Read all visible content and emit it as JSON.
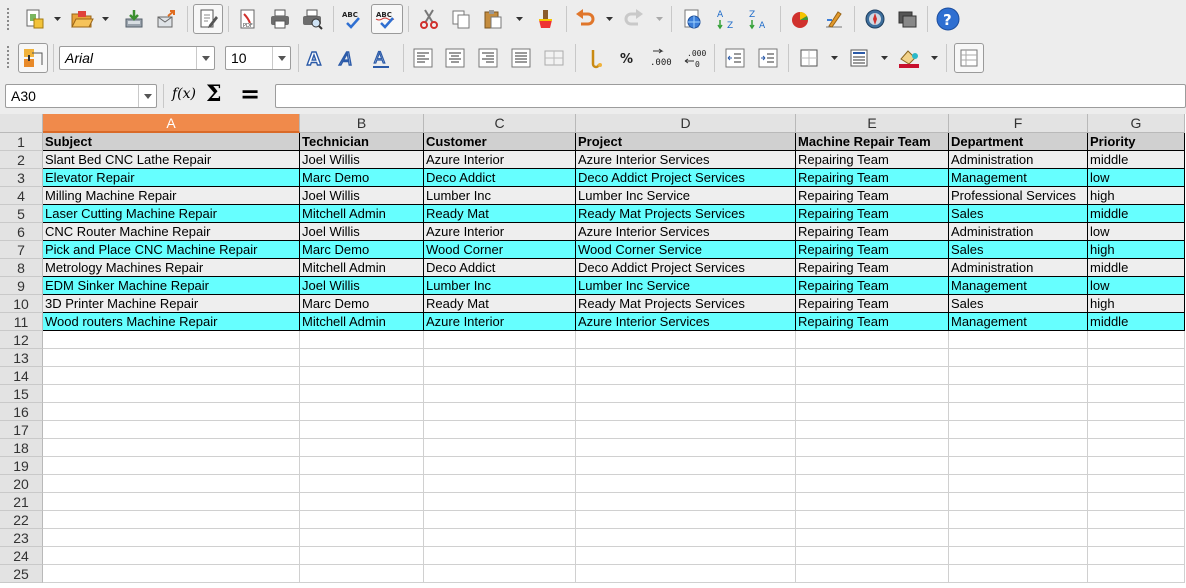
{
  "toolbar1": {
    "buttons": [
      "new-icon",
      "open-icon",
      "save-icon",
      "export-icon",
      "edit-file-icon",
      "export-pdf-icon",
      "print-icon",
      "print-preview-icon",
      "spellcheck-icon",
      "autospellcheck-icon",
      "cut-icon",
      "copy-icon",
      "paste-icon",
      "clone-format-icon",
      "undo-icon",
      "redo-icon",
      "hyperlink-icon",
      "sort-ascending-icon",
      "sort-descending-icon",
      "chart-icon",
      "pivot-table-icon",
      "navigator-icon",
      "gallery-icon",
      "help-icon"
    ]
  },
  "toolbar2": {
    "font_name": "Arial",
    "font_size": "10"
  },
  "formula_bar": {
    "name_box": "A30",
    "function_wizard": "f(x)",
    "sum_symbol": "Σ",
    "equals_symbol": "=",
    "formula_value": ""
  },
  "sheet": {
    "selected_column": "A",
    "columns": [
      "A",
      "B",
      "C",
      "D",
      "E",
      "F",
      "G"
    ],
    "row_numbers": [
      "1",
      "2",
      "3",
      "4",
      "5",
      "6",
      "7",
      "8",
      "9",
      "10",
      "11",
      "12",
      "13",
      "14",
      "15",
      "16",
      "17",
      "18",
      "19",
      "20",
      "21",
      "22",
      "23",
      "24",
      "25"
    ],
    "header_row": [
      "Subject",
      "Technician",
      "Customer",
      "Project",
      "Machine Repair Team",
      "Department",
      "Priority"
    ],
    "rows": [
      [
        "Slant Bed CNC Lathe Repair",
        "Joel Willis",
        "Azure Interior",
        "Azure Interior Services",
        "Repairing Team",
        "Administration",
        "middle"
      ],
      [
        "Elevator Repair",
        "Marc Demo",
        "Deco Addict",
        "Deco Addict Project Services",
        "Repairing Team",
        "Management",
        "low"
      ],
      [
        "Milling Machine Repair",
        "Joel Willis",
        "Lumber Inc",
        "Lumber Inc Service",
        "Repairing Team",
        "Professional Services",
        "high"
      ],
      [
        "Laser Cutting Machine Repair",
        "Mitchell Admin",
        "Ready Mat",
        "Ready Mat Projects Services",
        "Repairing Team",
        "Sales",
        "middle"
      ],
      [
        "CNC Router Machine Repair",
        "Joel Willis",
        "Azure Interior",
        "Azure Interior Services",
        "Repairing Team",
        "Administration",
        "low"
      ],
      [
        "Pick and Place CNC Machine Repair",
        "Marc Demo",
        "Wood Corner",
        "Wood Corner Service",
        "Repairing Team",
        "Sales",
        "high"
      ],
      [
        "Metrology Machines Repair",
        "Mitchell Admin",
        "Deco Addict",
        "Deco Addict Project Services",
        "Repairing Team",
        "Administration",
        "middle"
      ],
      [
        "EDM Sinker Machine Repair",
        "Joel Willis",
        "Lumber Inc",
        "Lumber Inc Service",
        "Repairing Team",
        "Management",
        "low"
      ],
      [
        "3D Printer Machine Repair",
        "Marc Demo",
        "Ready Mat",
        "Ready Mat Projects Services",
        "Repairing Team",
        "Sales",
        "high"
      ],
      [
        "Wood routers Machine Repair",
        "Mitchell Admin",
        "Azure Interior",
        "Azure Interior Services",
        "Repairing Team",
        "Management",
        "middle"
      ]
    ],
    "colors": {
      "stripe_even": "#eeeeee",
      "stripe_odd": "#66ffff",
      "header_fill": "#d0d0d0",
      "selected_column": "#f08a4b"
    }
  }
}
